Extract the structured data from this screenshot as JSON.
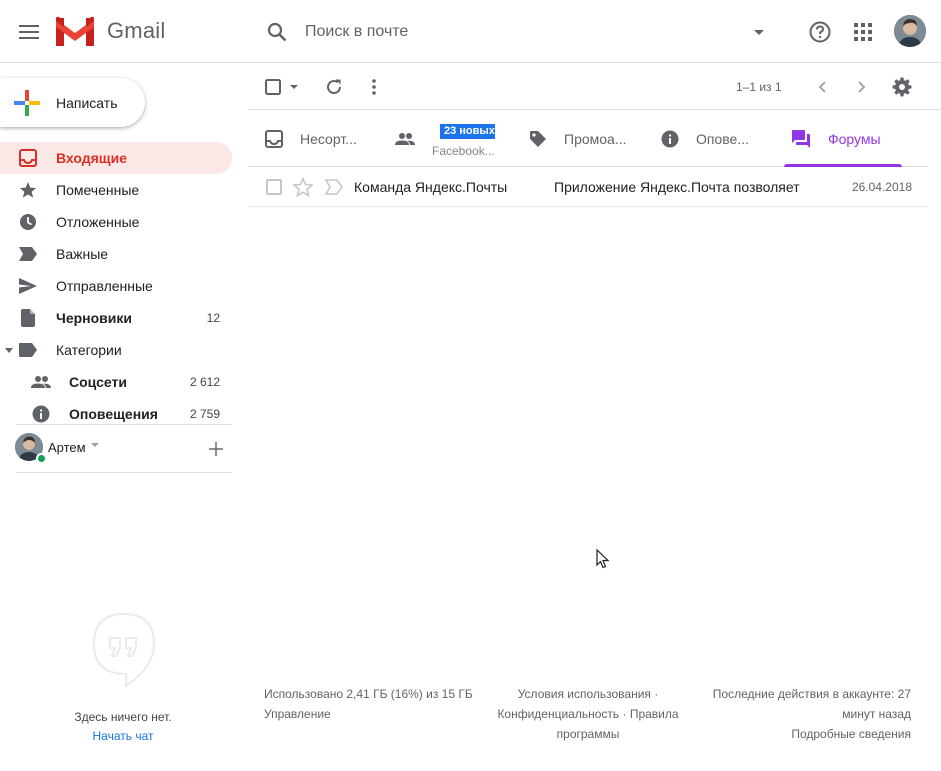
{
  "header": {
    "logo_text": "Gmail",
    "search_placeholder": "Поиск в почте"
  },
  "compose": {
    "label": "Написать"
  },
  "sidebar": {
    "items": [
      {
        "label": "Входящие",
        "count": ""
      },
      {
        "label": "Помеченные",
        "count": ""
      },
      {
        "label": "Отложенные",
        "count": ""
      },
      {
        "label": "Важные",
        "count": ""
      },
      {
        "label": "Отправленные",
        "count": ""
      },
      {
        "label": "Черновики",
        "count": "12"
      },
      {
        "label": "Категории",
        "count": ""
      },
      {
        "label": "Соцсети",
        "count": "2 612"
      },
      {
        "label": "Оповещения",
        "count": "2 759"
      }
    ]
  },
  "hangouts": {
    "user_name": "Артем",
    "empty_text": "Здесь ничего нет.",
    "start_chat": "Начать чат"
  },
  "toolbar": {
    "pager": "1–1 из 1"
  },
  "tabs": [
    {
      "label": "Несорт..."
    },
    {
      "label": "",
      "badge": "23 новых",
      "subtitle": "Facebook..."
    },
    {
      "label": "Промоа..."
    },
    {
      "label": "Опове..."
    },
    {
      "label": "Форумы"
    }
  ],
  "messages": [
    {
      "sender": "Команда Яндекс.Почты",
      "subject": "Приложение Яндекс.Почта позволяет",
      "date": "26.04.2018"
    }
  ],
  "footer": {
    "storage": "Использовано 2,41 ГБ (16%) из 15 ГБ",
    "manage": "Управление",
    "terms": "Условия использования ·",
    "privacy": "Конфиденциальность · Правила программы",
    "activity": "Последние действия в аккаунте: 27 минут назад",
    "details": "Подробные сведения"
  },
  "colors": {
    "accent_red": "#d93025",
    "active_bg": "#fce8e6",
    "forums_purple": "#9334e6",
    "badge_blue": "#1a73e8"
  }
}
